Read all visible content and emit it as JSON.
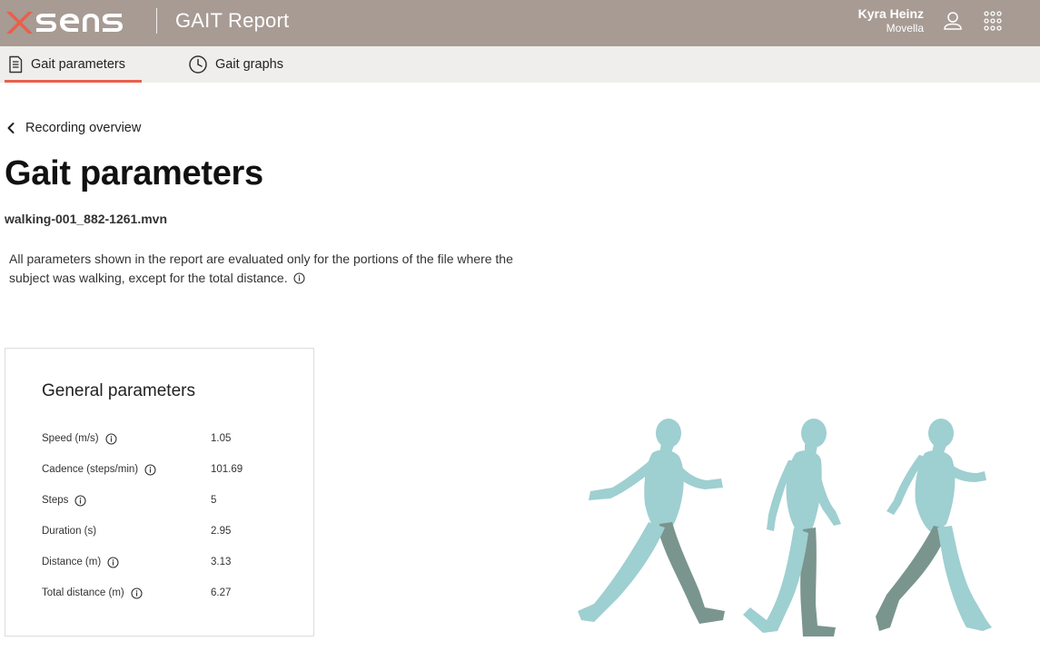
{
  "header": {
    "brand": "XSENS",
    "app_title": "GAIT Report",
    "user_name": "Kyra Heinz",
    "user_org": "Movella",
    "icons": [
      "user-icon",
      "apps-grid-icon"
    ],
    "colors": {
      "header_bg": "#a79b94",
      "logo_accent": "#e8604c",
      "tab_bar_bg": "#efeeec",
      "active_tab_underline": "#e8604c"
    }
  },
  "tabs": [
    {
      "label": "Gait parameters",
      "icon": "document-icon",
      "active": true
    },
    {
      "label": "Gait graphs",
      "icon": "clock-icon",
      "active": false
    }
  ],
  "back_link": {
    "label": "Recording overview",
    "icon": "chevron-left-icon"
  },
  "page": {
    "title": "Gait parameters",
    "file_name": "walking-001_882-1261.mvn",
    "description": "All parameters shown in the report are evaluated only for the portions of the file where the subject was walking, except for the total distance."
  },
  "general_parameters": {
    "title": "General parameters",
    "rows": [
      {
        "label": "Speed (m/s)",
        "value": "1.05",
        "has_info": true
      },
      {
        "label": "Cadence (steps/min)",
        "value": "101.69",
        "has_info": true
      },
      {
        "label": "Steps",
        "value": "5",
        "has_info": true
      },
      {
        "label": "Duration (s)",
        "value": "2.95",
        "has_info": false
      },
      {
        "label": "Distance (m)",
        "value": "3.13",
        "has_info": true
      },
      {
        "label": "Total distance (m)",
        "value": "6.27",
        "has_info": true
      }
    ]
  },
  "illustration": {
    "description_icon": "walking-figures-illustration",
    "colors": {
      "body": "#9ecfd1",
      "highlight_leg": "#7a958e"
    }
  }
}
